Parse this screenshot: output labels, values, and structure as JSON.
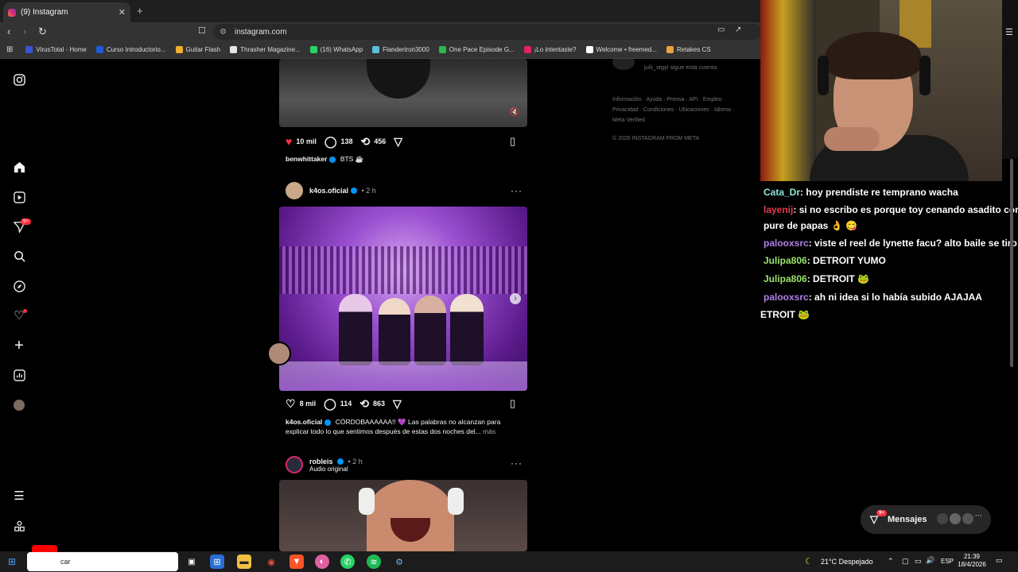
{
  "browser": {
    "tab_title": "(9) Instagram",
    "tab_close": "✕",
    "new_tab": "+",
    "url": "instagram.com",
    "bookmarks": [
      {
        "label": "VirusTotal - Home",
        "color": "#3954d6"
      },
      {
        "label": "Curso Introductorio...",
        "color": "#1e5bd6"
      },
      {
        "label": "Guitar Flash",
        "color": "#f0b030"
      },
      {
        "label": "Thrasher Magazine...",
        "color": "#e6e6e6"
      },
      {
        "label": "(16) WhatsApp",
        "color": "#25d366"
      },
      {
        "label": "Flandertron3000",
        "color": "#5bc0de"
      },
      {
        "label": "One Pace Episode G...",
        "color": "#2eb84a"
      },
      {
        "label": "¡Lo intentaste?",
        "color": "#e0245e"
      },
      {
        "label": "Welcome • freemed...",
        "color": "#ffffff"
      },
      {
        "label": "Retakes CS",
        "color": "#e8a33a"
      }
    ]
  },
  "instagram": {
    "nav_badge": "9+",
    "post1": {
      "likes": "10 mil",
      "comments": "138",
      "reposts": "456",
      "username": "benwhittaker",
      "caption": "BTS ☕"
    },
    "post2": {
      "username": "k4os.oficial",
      "time": "2 h",
      "likes": "8 mil",
      "comments": "114",
      "reposts": "863",
      "caption_user": "k4os.oficial",
      "caption": "CÓRDOBAAAAAA!! 💜 Las palabras no alcanzan para explicar todo lo que sentimos después de estas dos noches del...",
      "more": "más"
    },
    "post3": {
      "username": "robleis",
      "time": "2 h",
      "subtitle": "Audio original"
    },
    "right": {
      "follow_note": "julii_stgyi sigue esta cuenta",
      "footer_links": "Información · Ayuda · Prensa · API · Empleo · Privacidad · Condiciones · Ubicaciones · Idioma · Meta Verified",
      "copyright": "© 2026 INSTAGRAM FROM META"
    },
    "messages_label": "Mensajes",
    "messages_badge": "9+"
  },
  "chat": [
    {
      "user": "Cata_Dr",
      "color": "#8ee7d8",
      "text": ": hoy prendiste re temprano wacha"
    },
    {
      "user": "layenij",
      "color": "#e8384f",
      "text": ": si no escribo es porque toy cenando asadito con"
    },
    {
      "user": "",
      "color": "#ffffff",
      "text": "pure de papas 👌 😋"
    },
    {
      "user": "palooxsrc",
      "color": "#b07ee8",
      "text": ": viste el reel de lynette facu? alto baile se tiro"
    },
    {
      "user": "Julipa806",
      "color": "#9be36c",
      "text": ": DETROIT YUMO"
    },
    {
      "user": "Julipa806",
      "color": "#9be36c",
      "text": ": DETROIT 🐸"
    },
    {
      "user": "palooxsrc",
      "color": "#b07ee8",
      "text": ": ah ni idea si lo había subido AJAJAA"
    },
    {
      "user": "",
      "color": "#ffffff",
      "text": "ETROIT 🐸"
    }
  ],
  "taskbar": {
    "search": "car",
    "weather": "21°C  Despejado",
    "lang": "ESP",
    "time": "21:39",
    "date": "18/4/2026"
  }
}
